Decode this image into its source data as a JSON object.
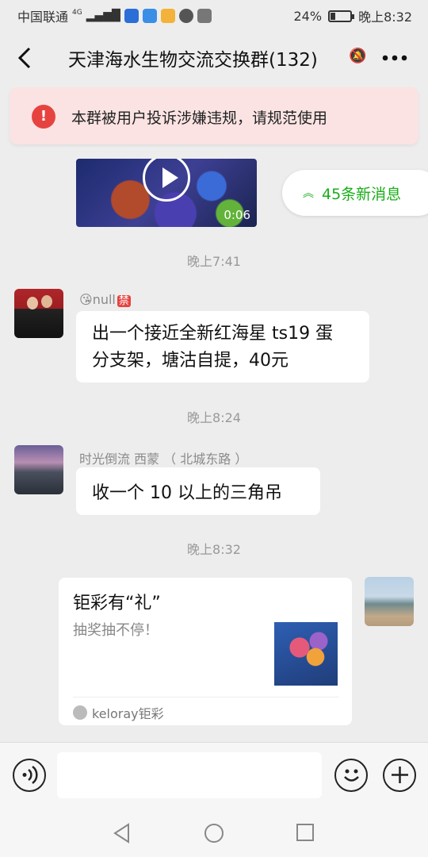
{
  "status_bar": {
    "carrier": "中国联通",
    "network": "4G",
    "battery": "24%",
    "battery_level": 0.24,
    "time": "晚上8:32"
  },
  "header": {
    "back_icon": "chevron-left-icon",
    "title": "天津海水生物交流交换群(132)",
    "more_icon": "more-dots-icon"
  },
  "warning": {
    "icon": "!",
    "text": "本群被用户投诉涉嫌违规，请规范使用",
    "color": "#e64340"
  },
  "new_messages": {
    "label": "45条新消息",
    "color": "#1aad19"
  },
  "video": {
    "duration": "0:06"
  },
  "messages": {
    "time1": "晚上7:41",
    "m1": {
      "sender": "null",
      "badge": "禁",
      "text_line1": "出一个接近全新红海星 ts19 蛋",
      "text_line2": "分支架，塘沽自提，40元"
    },
    "time2": "晚上8:24",
    "m2": {
      "sender": "时光倒流 西蒙 （ 北城东路 ）",
      "text": "收一个 10 以上的三角吊"
    },
    "time3": "晚上8:32",
    "m3": {
      "card_title": "钜彩有“礼”",
      "card_desc": "抽奖抽不停！",
      "card_source": "keloray钜彩"
    }
  },
  "input_bar": {
    "voice_icon": "voice-icon",
    "emoji_icon": "emoji-icon",
    "plus_icon": "plus-icon",
    "text_value": ""
  },
  "nav_bar": {
    "back": "back-triangle-icon",
    "home": "home-circle-icon",
    "recent": "recent-square-icon"
  }
}
